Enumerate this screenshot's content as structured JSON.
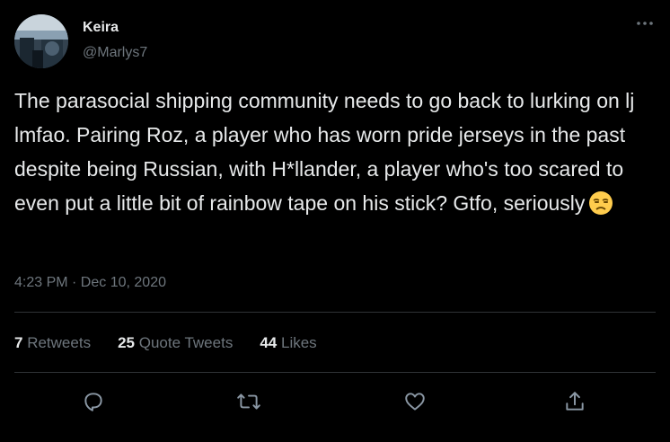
{
  "user": {
    "name": "Keira",
    "handle": "@Marlys7"
  },
  "tweet": {
    "text": "The parasocial shipping community needs to go back to lurking on lj lmfao. Pairing Roz, a player who has worn pride jerseys in the past despite being Russian, with H*llander, a player who's too scared to even put a little bit of rainbow tape on his stick? Gtfo, seriously",
    "emoji": "unamused-face",
    "timestamp": "4:23 PM · Dec 10, 2020"
  },
  "stats": {
    "retweets_count": "7",
    "retweets_label": "Retweets",
    "quote_count": "25",
    "quote_label": "Quote Tweets",
    "likes_count": "44",
    "likes_label": "Likes"
  },
  "actions": [
    "reply-icon",
    "retweet-icon",
    "like-icon",
    "share-icon"
  ],
  "colors": {
    "background": "#000000",
    "text": "#e7e9ea",
    "muted": "#6e767d",
    "divider": "#2f3336"
  }
}
